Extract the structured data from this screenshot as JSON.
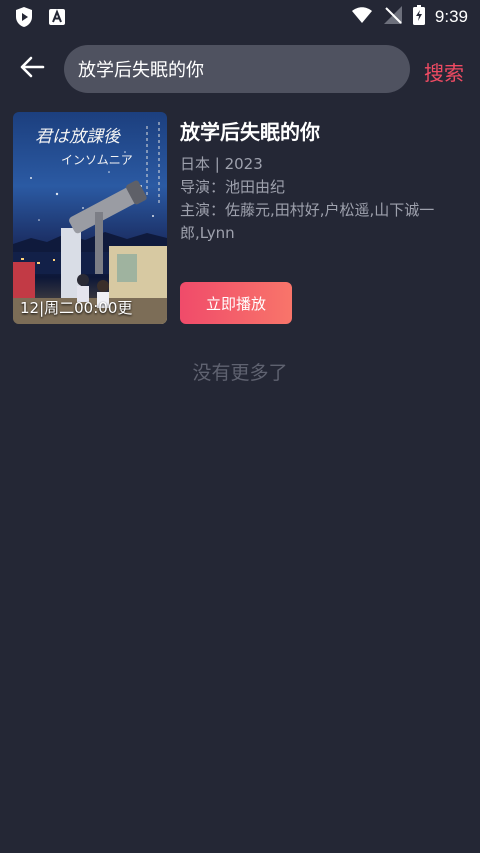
{
  "status_bar": {
    "time": "9:39"
  },
  "search": {
    "query": "放学后失眠的你",
    "button_label": "搜索"
  },
  "result": {
    "poster_caption": "12|周二00:00更",
    "title": "放学后失眠的你",
    "region_year": "日本 | 2023",
    "director": "导演：池田由纪",
    "cast": "主演：佐藤元,田村好,户松遥,山下诚一郎,Lynn",
    "play_label": "立即播放"
  },
  "end_note": "没有更多了",
  "colors": {
    "background": "#242735",
    "accent": "#ef4b63",
    "search_field": "#4f5260"
  }
}
